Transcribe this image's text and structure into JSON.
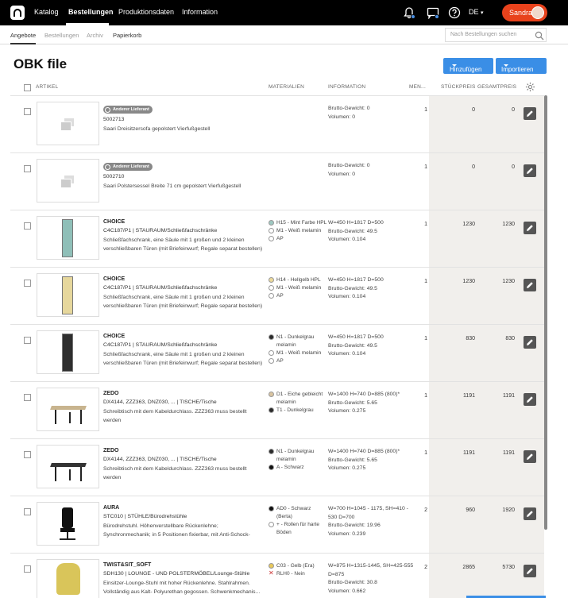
{
  "nav": {
    "items": [
      "Katalog",
      "Bestellungen",
      "Produktionsdaten",
      "Information"
    ],
    "language": "DE",
    "user": "Sandra"
  },
  "subnav": {
    "items": [
      "Angebote",
      "Bestellungen",
      "Archiv",
      "Papierkorb"
    ],
    "search_placeholder": "Nach Bestellungen suchen"
  },
  "page": {
    "title": "OBK file",
    "add_button": "Hinzufügen",
    "import_button": "Importieren"
  },
  "table": {
    "columns": {
      "article": "ARTIKEL",
      "materials": "MATERIALIEN",
      "information": "INFORMATION",
      "quantity": "MEN...",
      "unit_price": "STÜCKPREIS",
      "total_price": "GESAMTPREIS"
    },
    "rows": [
      {
        "badge": "Anderer Lieferant",
        "code": "5002713",
        "desc": "Saari Dreisitzersofa gepolstert Vierfußgestell",
        "materials": [],
        "info": [
          "Brutto-Gewicht: 0",
          "Volumen: 0"
        ],
        "qty": "1",
        "unit": "0",
        "total": "0"
      },
      {
        "badge": "Anderer Lieferant",
        "code": "5002710",
        "desc": "Saari Polstersessel Breite 71 cm gepolstert Vierfußgestell",
        "materials": [],
        "info": [
          "Brutto-Gewicht: 0",
          "Volumen: 0"
        ],
        "qty": "1",
        "unit": "0",
        "total": "0"
      },
      {
        "name": "CHOICE",
        "path": "C4C187/P1 | STAURAUM/Schließfachschränke",
        "desc": "Schließfachschrank, eine Säule mit 1 großen und 2 kleinen verschließbaren Türen (mit Briefeinwurf; Regale separat bestellen)",
        "materials": [
          {
            "label": "H15 - Mint Farbe HPL",
            "color": "#9ec9c2"
          },
          {
            "label": "M1 - Weiß melamin",
            "color": "#ffffff"
          },
          {
            "label": "AP",
            "color": "#ffffff"
          }
        ],
        "info": [
          "W=450 H=1817 D=500",
          "Brutto-Gewicht: 49.5",
          "Volumen: 0.104"
        ],
        "qty": "1",
        "unit": "1230",
        "total": "1230"
      },
      {
        "name": "CHOICE",
        "path": "C4C187/P1 | STAURAUM/Schließfachschränke",
        "desc": "Schließfachschrank, eine Säule mit 1 großen und 2 kleinen verschließbaren Türen (mit Briefeinwurf; Regale separat bestellen)",
        "materials": [
          {
            "label": "H14 - Hellgelb HPL",
            "color": "#ecd99a"
          },
          {
            "label": "M1 - Weiß melamin",
            "color": "#ffffff"
          },
          {
            "label": "AP",
            "color": "#ffffff"
          }
        ],
        "info": [
          "W=450 H=1817 D=500",
          "Brutto-Gewicht: 49.5",
          "Volumen: 0.104"
        ],
        "qty": "1",
        "unit": "1230",
        "total": "1230"
      },
      {
        "name": "CHOICE",
        "path": "C4C187/P1 | STAURAUM/Schließfachschränke",
        "desc": "Schließfachschrank, eine Säule mit 1 großen und 2 kleinen verschließbaren Türen (mit Briefeinwurf; Regale separat bestellen)",
        "materials": [
          {
            "label": "N1 - Dunkelgrau melamin",
            "color": "#2b2b2b"
          },
          {
            "label": "M1 - Weiß melamin",
            "color": "#ffffff"
          },
          {
            "label": "AP",
            "color": "#ffffff"
          }
        ],
        "info": [
          "W=450 H=1817 D=500",
          "Brutto-Gewicht: 49.5",
          "Volumen: 0.104"
        ],
        "qty": "1",
        "unit": "830",
        "total": "830"
      },
      {
        "name": "ZEDO",
        "path": "DX4144, ZZZ363, DNZ030, ... | TISCHE/Tische",
        "desc": "Schreibtisch mit dem Kabeldurchlass. ZZZ363 muss bestellt werden",
        "materials": [
          {
            "label": "D1 - Eiche gebleicht melamin",
            "color": "#d9c4a0"
          },
          {
            "label": "T1 - Dunkelgrau",
            "color": "#2b2b2b"
          }
        ],
        "info": [
          "W=1400 H=740 D=885 (800)*",
          "Brutto-Gewicht: 5.65",
          "Volumen: 0.275"
        ],
        "qty": "1",
        "unit": "1191",
        "total": "1191"
      },
      {
        "name": "ZEDO",
        "path": "DX4144, ZZZ363, DNZ030, ... | TISCHE/Tische",
        "desc": "Schreibtisch mit dem Kabeldurchlass. ZZZ363 muss bestellt werden",
        "materials": [
          {
            "label": "N1 - Dunkelgrau melamin",
            "color": "#2b2b2b"
          },
          {
            "label": "A - Schwarz",
            "color": "#111111"
          }
        ],
        "info": [
          "W=1400 H=740 D=885 (800)*",
          "Brutto-Gewicht: 5.65",
          "Volumen: 0.275"
        ],
        "qty": "1",
        "unit": "1191",
        "total": "1191"
      },
      {
        "name": "AURA",
        "path": "STC010 | STÜHLE/Bürodrehstühle",
        "desc": "Bürodrehstuhl. Höhenverstellbare Rückenlehne; Synchronmechanik; in 5 Positionen fixierbar, mit Anti-Schock-Sicherung und ...",
        "materials": [
          {
            "label": "AD0 - Schwarz (Berta)",
            "color": "#111111"
          },
          {
            "label": "+ - Rollen für harte Böden",
            "color": "#ffffff"
          }
        ],
        "info": [
          "W=700 H=1045 - 1175, SH=410 - 530 D=700",
          "Brutto-Gewicht: 19.96",
          "Volumen: 0.239"
        ],
        "qty": "2",
        "unit": "960",
        "total": "1920"
      },
      {
        "name": "TWIST&SIT_SOFT",
        "path": "SDH130 | LOUNGE - UND POLSTERMÖBEL/Lounge-Stühle",
        "desc": "Einsitzer-Lounge-Stuhl mit hoher Rückenlehne. Stahlrahmen. Vollständig aus Kalt- Polyurethan gegossen. Schwenkmechanis...",
        "materials": [
          {
            "label": "C03 - Gelb (Era)",
            "color": "#e8c85a"
          },
          {
            "label": "RLH0 - Nein",
            "color": "none"
          }
        ],
        "info": [
          "W=875 H=1315-1445, SH=425-555 D=875",
          "Brutto-Gewicht: 30.8",
          "Volumen: 0.662"
        ],
        "qty": "2",
        "unit": "2865",
        "total": "5730"
      }
    ]
  },
  "colors": {
    "accent": "#3a8ee6",
    "user_button": "#e8421c",
    "topbar": "#000000"
  }
}
